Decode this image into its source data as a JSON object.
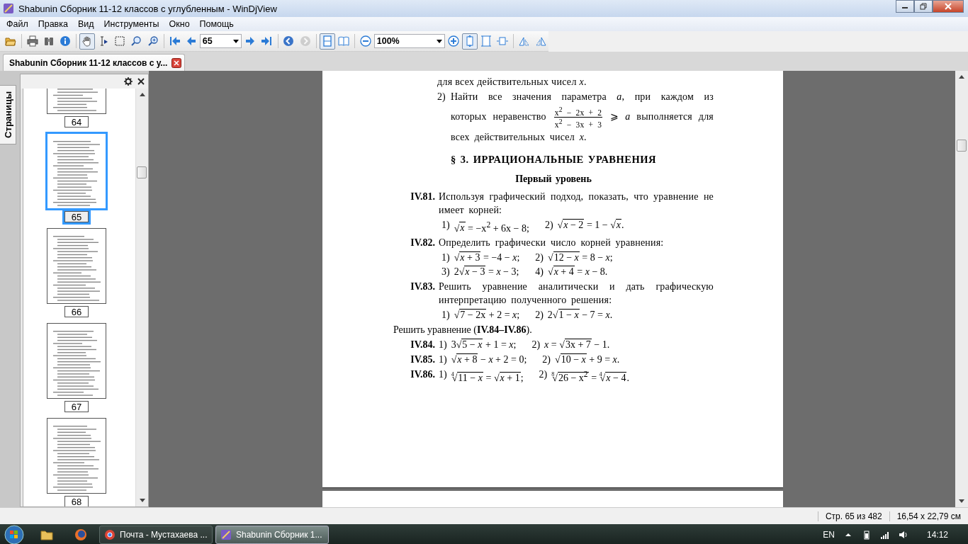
{
  "window": {
    "title": "Shabunin Сборник 11-12 классов с углубленным - WinDjView"
  },
  "menu": [
    "Файл",
    "Правка",
    "Вид",
    "Инструменты",
    "Окно",
    "Помощь"
  ],
  "toolbar": [
    {
      "kind": "button",
      "selected": false,
      "disabled": false
    },
    {
      "kind": "separator"
    },
    {
      "kind": "button",
      "selected": false,
      "disabled": false
    },
    {
      "kind": "button",
      "selected": false,
      "disabled": false
    },
    {
      "kind": "button",
      "selected": false,
      "disabled": false
    },
    {
      "kind": "separator"
    },
    {
      "kind": "button",
      "selected": true,
      "disabled": false
    },
    {
      "kind": "button",
      "selected": false,
      "disabled": false
    },
    {
      "kind": "button",
      "selected": false,
      "disabled": false
    },
    {
      "kind": "button",
      "selected": false,
      "disabled": false
    },
    {
      "kind": "button",
      "selected": false,
      "disabled": false
    },
    {
      "kind": "separator"
    },
    {
      "kind": "button",
      "selected": false,
      "disabled": false
    },
    {
      "kind": "button",
      "selected": false,
      "disabled": false
    },
    {
      "kind": "combo",
      "value": "65"
    },
    {
      "kind": "button",
      "selected": false,
      "disabled": false
    },
    {
      "kind": "button",
      "selected": false,
      "disabled": false
    },
    {
      "kind": "separator"
    },
    {
      "kind": "button",
      "selected": false,
      "disabled": false
    },
    {
      "kind": "button",
      "selected": false,
      "disabled": true
    },
    {
      "kind": "separator"
    },
    {
      "kind": "button",
      "selected": true,
      "disabled": false
    },
    {
      "kind": "button",
      "selected": false,
      "disabled": false
    },
    {
      "kind": "separator"
    },
    {
      "kind": "button",
      "selected": false,
      "disabled": false
    },
    {
      "kind": "combo",
      "value": "100%"
    },
    {
      "kind": "button",
      "selected": false,
      "disabled": false
    },
    {
      "kind": "button",
      "selected": true,
      "disabled": false
    },
    {
      "kind": "button",
      "selected": false,
      "disabled": false
    },
    {
      "kind": "button",
      "selected": false,
      "disabled": false
    },
    {
      "kind": "separator"
    },
    {
      "kind": "button",
      "selected": false,
      "disabled": false
    },
    {
      "kind": "button",
      "selected": false,
      "disabled": false
    }
  ],
  "tabs": [
    {
      "label": "Shabunin Сборник 11-12 классов с у...",
      "selected": true
    }
  ],
  "sidebar": {
    "tab": "Страницы",
    "thumbnails": [
      {
        "label": "64",
        "selected": false
      },
      {
        "label": "65",
        "selected": true
      },
      {
        "label": "66",
        "selected": false
      },
      {
        "label": "67",
        "selected": false
      },
      {
        "label": "68",
        "selected": false
      }
    ]
  },
  "page": {
    "blocks": [
      {
        "kind": "continuation",
        "segments": [
          {
            "kind": "text",
            "text": "для всех действительных чисел *x*."
          }
        ]
      },
      {
        "kind": "item",
        "label": "2)",
        "segments": [
          {
            "kind": "text",
            "text": "Найти все значения параметра *a*, при каждом из которых неравенство "
          },
          {
            "kind": "frac",
            "numerator": "x$^{2}$ − 2x + 2",
            "denominator": "x$^{2}$ − 3x + 3"
          },
          {
            "kind": "text",
            "text": " ⩾ *a* выполняется для всех действительных чисел *x*."
          }
        ]
      },
      {
        "kind": "heading",
        "text": "§ 3. ИРРАЦИОНАЛЬНЫЕ УРАВНЕНИЯ"
      },
      {
        "kind": "subheading",
        "text": "Первый уровень"
      },
      {
        "kind": "problem",
        "number": "IV.81.",
        "text": "Используя графический подход, показать, что уравнение не имеет корней:",
        "rows": [
          [
            {
              "label": "1)",
              "segments": [
                {
                  "kind": "root",
                  "sign": "√",
                  "text": "*x*"
                },
                {
                  "kind": "text",
                  "text": " = −x$^{2}$ + 6x − 8;"
                }
              ]
            },
            {
              "label": "2)",
              "segments": [
                {
                  "kind": "root",
                  "sign": "√",
                  "text": "*x* − 2"
                },
                {
                  "kind": "text",
                  "text": " = 1 − "
                },
                {
                  "kind": "root",
                  "sign": "√",
                  "text": "*x*"
                },
                {
                  "kind": "text",
                  "text": "."
                }
              ]
            }
          ]
        ]
      },
      {
        "kind": "problem",
        "number": "IV.82.",
        "text": "Определить графически число корней уравнения:",
        "rows": [
          [
            {
              "label": "1)",
              "segments": [
                {
                  "kind": "root",
                  "sign": "√",
                  "text": "*x* + 3"
                },
                {
                  "kind": "text",
                  "text": " = −4 − *x*;"
                }
              ]
            },
            {
              "label": "2)",
              "segments": [
                {
                  "kind": "root",
                  "sign": "√",
                  "text": "12 − *x*"
                },
                {
                  "kind": "text",
                  "text": " = 8 − *x*;"
                }
              ]
            }
          ],
          [
            {
              "label": "3)",
              "segments": [
                {
                  "kind": "text",
                  "text": "2"
                },
                {
                  "kind": "root",
                  "sign": "√",
                  "text": "*x* − 3"
                },
                {
                  "kind": "text",
                  "text": " = *x* − 3;"
                }
              ]
            },
            {
              "label": "4)",
              "segments": [
                {
                  "kind": "root",
                  "sign": "√",
                  "text": "*x* + 4"
                },
                {
                  "kind": "text",
                  "text": " = *x* − 8."
                }
              ]
            }
          ]
        ]
      },
      {
        "kind": "problem",
        "number": "IV.83.",
        "text": "Решить уравнение аналитически и дать графическую интерпретацию полученного решения:",
        "rows": [
          [
            {
              "label": "1)",
              "segments": [
                {
                  "kind": "root",
                  "sign": "√",
                  "text": "7 − 2x"
                },
                {
                  "kind": "text",
                  "text": " + 2 = *x*;"
                }
              ]
            },
            {
              "label": "2)",
              "segments": [
                {
                  "kind": "text",
                  "text": "2"
                },
                {
                  "kind": "root",
                  "sign": "√",
                  "text": "1 − *x*"
                },
                {
                  "kind": "text",
                  "text": " − 7 = *x*."
                }
              ]
            }
          ]
        ]
      },
      {
        "kind": "intro",
        "text": "Решить уравнение (**IV.84–IV.86**)."
      },
      {
        "kind": "problem",
        "number": "IV.84.",
        "rows": [
          [
            {
              "label": "1)",
              "segments": [
                {
                  "kind": "text",
                  "text": "3"
                },
                {
                  "kind": "root",
                  "sign": "√",
                  "text": "5 − *x*"
                },
                {
                  "kind": "text",
                  "text": " + 1 = *x*;"
                }
              ]
            },
            {
              "label": "2)",
              "segments": [
                {
                  "kind": "text",
                  "text": "*x* = "
                },
                {
                  "kind": "root",
                  "sign": "√",
                  "text": "3x + 7"
                },
                {
                  "kind": "text",
                  "text": " − 1."
                }
              ]
            }
          ]
        ]
      },
      {
        "kind": "problem",
        "number": "IV.85.",
        "rows": [
          [
            {
              "label": "1)",
              "segments": [
                {
                  "kind": "root",
                  "sign": "√",
                  "text": "*x* + 8"
                },
                {
                  "kind": "text",
                  "text": " − *x* + 2 = 0;"
                }
              ]
            },
            {
              "label": "2)",
              "segments": [
                {
                  "kind": "root",
                  "sign": "√",
                  "text": "10 − *x*"
                },
                {
                  "kind": "text",
                  "text": " + 9 = *x*."
                }
              ]
            }
          ]
        ]
      },
      {
        "kind": "problem",
        "number": "IV.86.",
        "rows": [
          [
            {
              "label": "1)",
              "segments": [
                {
                  "kind": "root",
                  "index": "4",
                  "sign": "√",
                  "text": "11 − *x*"
                },
                {
                  "kind": "text",
                  "text": " = "
                },
                {
                  "kind": "root",
                  "sign": "√",
                  "text": "*x* + 1"
                },
                {
                  "kind": "text",
                  "text": ";"
                }
              ]
            },
            {
              "label": "2)",
              "segments": [
                {
                  "kind": "root",
                  "index": "8",
                  "sign": "√",
                  "text": "26 − x$^{2}$"
                },
                {
                  "kind": "text",
                  "text": " = "
                },
                {
                  "kind": "root",
                  "index": "4",
                  "sign": "√",
                  "text": "*x* − 4"
                },
                {
                  "kind": "text",
                  "text": "."
                }
              ]
            }
          ]
        ]
      }
    ]
  },
  "status_bar": [
    "Стр. 65 из 482",
    "16,54 x 22,79 см"
  ],
  "taskbar": {
    "tasks": [
      {
        "label": "Почта - Мустахаева ...",
        "selected": false
      },
      {
        "label": "Shabunin Сборник 1...",
        "selected": true
      }
    ],
    "language": "EN",
    "time": "14:12"
  }
}
